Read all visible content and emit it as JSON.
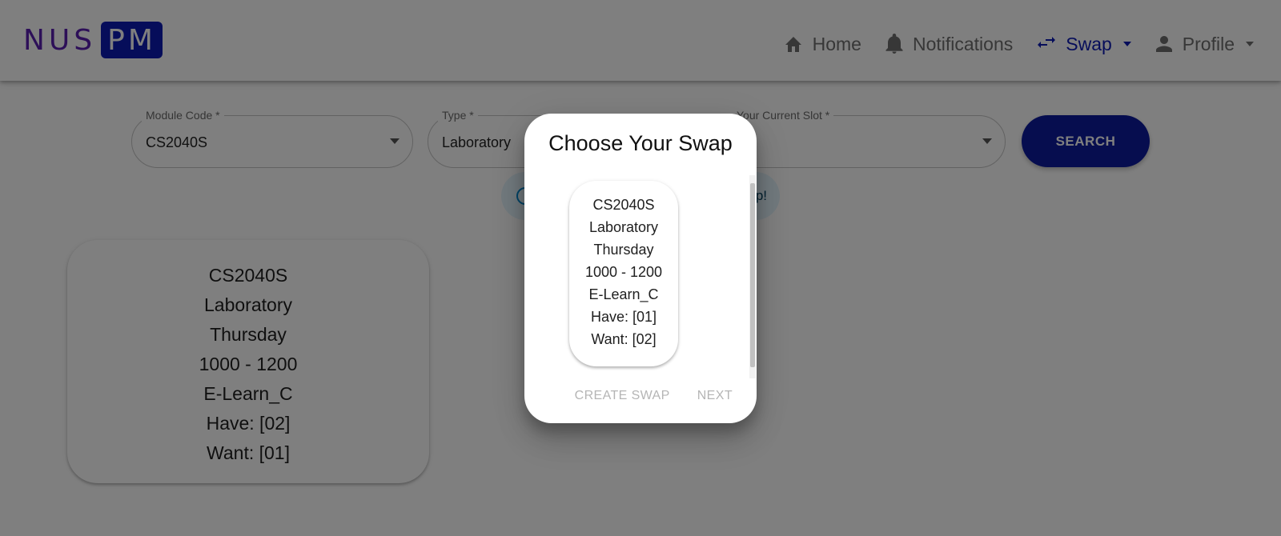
{
  "brand": {
    "part1": "NUS",
    "part2": "PM"
  },
  "nav": {
    "home": "Home",
    "notifications": "Notifications",
    "swap": "Swap",
    "profile": "Profile"
  },
  "form": {
    "module_code": {
      "label": "Module Code *",
      "value": "CS2040S"
    },
    "type": {
      "label": "Type *",
      "value": "Laboratory"
    },
    "current_slot": {
      "label": "Your Current Slot *",
      "value": ""
    },
    "search_label": "SEARCH"
  },
  "alert": {
    "text": "p!"
  },
  "result_card": {
    "module": "CS2040S",
    "type": "Laboratory",
    "day": "Thursday",
    "time": "1000 - 1200",
    "venue": "E-Learn_C",
    "have": "Have: [02]",
    "want": "Want: [01]"
  },
  "dialog": {
    "title": "Choose Your Swap",
    "option": {
      "module": "CS2040S",
      "type": "Laboratory",
      "day": "Thursday",
      "time": "1000 - 1200",
      "venue": "E-Learn_C",
      "have": "Have: [01]",
      "want": "Want: [02]"
    },
    "create_swap_label": "CREATE SWAP",
    "next_label": "NEXT"
  },
  "colors": {
    "primary": "#0d1b9e",
    "brand_purple": "#5b1fb0",
    "nav_active": "#0d1bb5",
    "nav_inactive": "#6f6f6f",
    "disabled_text": "#b5b5b5"
  },
  "icons": {
    "home": "home-icon",
    "notifications": "bell-icon",
    "swap": "swap-arrows-icon",
    "profile": "person-icon",
    "dropdown": "caret-down-icon",
    "alert": "info-icon"
  }
}
